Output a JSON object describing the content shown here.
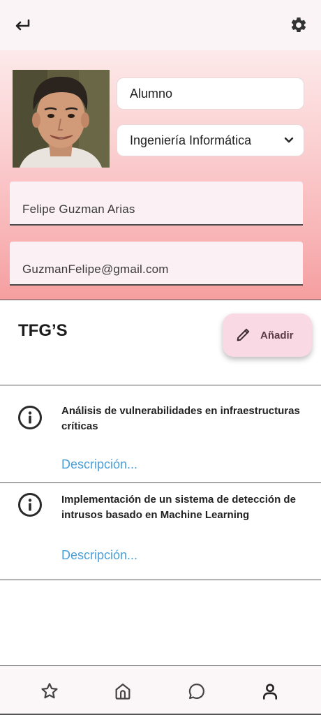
{
  "header": {
    "back_icon": "back-arrow-icon",
    "settings_icon": "gear-icon"
  },
  "profile": {
    "role": "Alumno",
    "degree": "Ingeniería Informática",
    "name": "Felipe Guzman Arias",
    "email": "GuzmanFelipe@gmail.com"
  },
  "tfg": {
    "title": "TFG’S",
    "add_label": "Añadir",
    "items": [
      {
        "title": "Análisis de vulnerabilidades en infraestructuras críticas",
        "description": "Descripción..."
      },
      {
        "title": "Implementación de un sistema de detección de intrusos basado en Machine Learning",
        "description": "Descripción..."
      }
    ]
  },
  "bottom_nav": {
    "items": [
      "star-icon",
      "home-icon",
      "chat-icon",
      "profile-icon"
    ],
    "active": "profile-icon"
  },
  "colors": {
    "accent_link": "#4a9fd8",
    "add_button": "#f9d9e4",
    "gradient_top": "#fde9ea",
    "gradient_bottom": "#f59e9f"
  }
}
